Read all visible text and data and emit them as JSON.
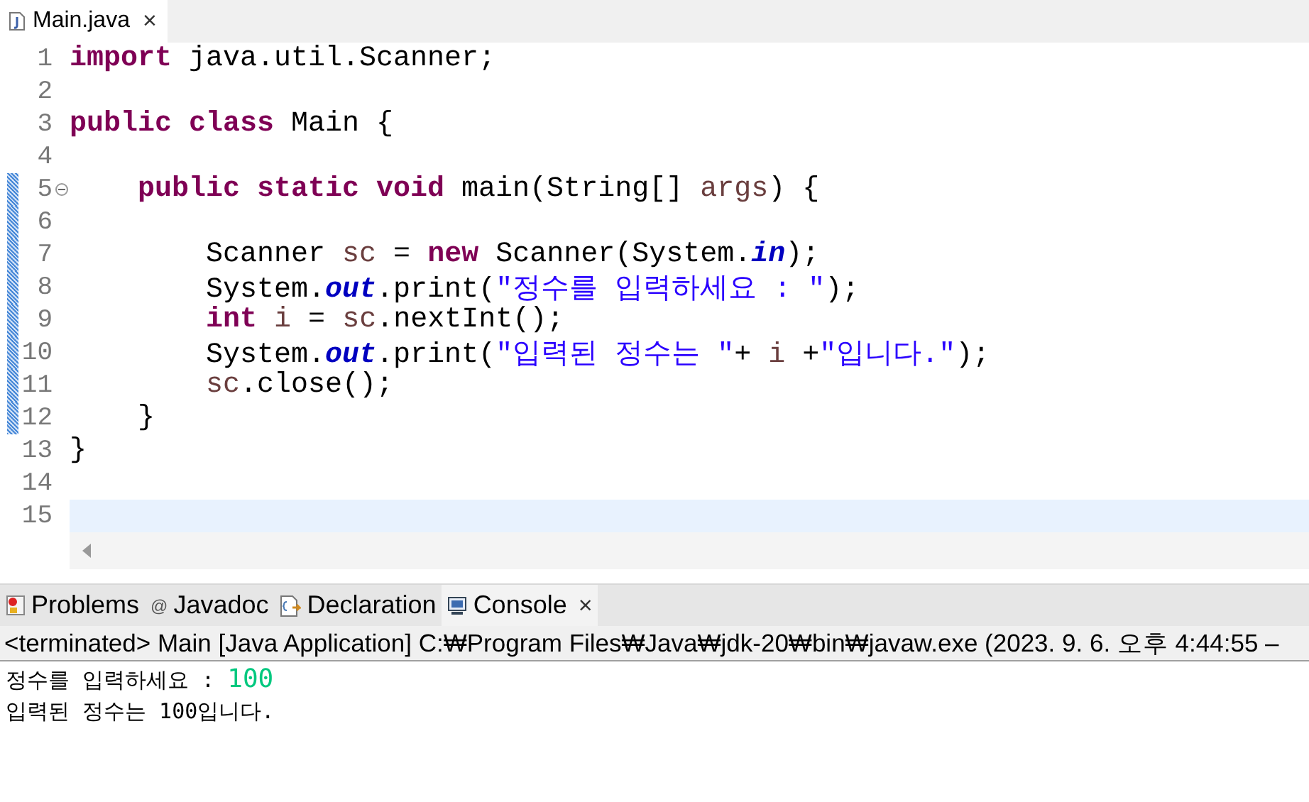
{
  "editor_tabs": [
    {
      "label": "Main.java",
      "selected": true,
      "close": "×"
    }
  ],
  "code": [
    {
      "number": "1",
      "changed": false,
      "current": false,
      "fold": false,
      "tokens": [
        {
          "kind": "kw",
          "text": "import"
        },
        {
          "kind": "plain",
          "text": " java.util.Scanner;"
        }
      ]
    },
    {
      "number": "2",
      "changed": false,
      "current": false,
      "fold": false
    },
    {
      "number": "3",
      "changed": false,
      "current": false,
      "fold": false,
      "tokens": [
        {
          "kind": "kw",
          "text": "public class"
        },
        {
          "kind": "plain",
          "text": " Main {"
        }
      ]
    },
    {
      "number": "4",
      "changed": false,
      "current": false,
      "fold": false
    },
    {
      "number": "5",
      "changed": true,
      "current": false,
      "fold": true,
      "tokens": [
        {
          "kind": "kw",
          "text": "    public static void"
        },
        {
          "kind": "plain",
          "text": " main(String[] "
        },
        {
          "kind": "param",
          "text": "args"
        },
        {
          "kind": "plain",
          "text": ") {"
        }
      ]
    },
    {
      "number": "6",
      "changed": true,
      "current": false,
      "fold": false
    },
    {
      "number": "7",
      "changed": true,
      "current": false,
      "fold": false,
      "tokens": [
        {
          "kind": "plain",
          "text": "        Scanner "
        },
        {
          "kind": "local",
          "text": "sc"
        },
        {
          "kind": "plain",
          "text": " = "
        },
        {
          "kind": "kw",
          "text": "new"
        },
        {
          "kind": "plain",
          "text": " Scanner(System."
        },
        {
          "kind": "field",
          "text": "in"
        },
        {
          "kind": "plain",
          "text": ");"
        }
      ]
    },
    {
      "number": "8",
      "changed": true,
      "current": false,
      "fold": false,
      "tokens": [
        {
          "kind": "plain",
          "text": "        System."
        },
        {
          "kind": "field",
          "text": "out"
        },
        {
          "kind": "plain",
          "text": ".print("
        },
        {
          "kind": "str",
          "text": "\"정수를 입력하세요 : \""
        },
        {
          "kind": "plain",
          "text": ");"
        }
      ]
    },
    {
      "number": "9",
      "changed": true,
      "current": false,
      "fold": false,
      "tokens": [
        {
          "kind": "kw",
          "text": "        int"
        },
        {
          "kind": "local",
          "text": " i"
        },
        {
          "kind": "plain",
          "text": " = "
        },
        {
          "kind": "local",
          "text": "sc"
        },
        {
          "kind": "plain",
          "text": ".nextInt();"
        }
      ]
    },
    {
      "number": "10",
      "changed": true,
      "current": false,
      "fold": false,
      "tokens": [
        {
          "kind": "plain",
          "text": "        System."
        },
        {
          "kind": "field",
          "text": "out"
        },
        {
          "kind": "plain",
          "text": ".print("
        },
        {
          "kind": "str",
          "text": "\"입력된 정수는 \""
        },
        {
          "kind": "plain",
          "text": "+ "
        },
        {
          "kind": "local",
          "text": "i"
        },
        {
          "kind": "plain",
          "text": " +"
        },
        {
          "kind": "str",
          "text": "\"입니다.\""
        },
        {
          "kind": "plain",
          "text": ");"
        }
      ]
    },
    {
      "number": "11",
      "changed": true,
      "current": false,
      "fold": false,
      "tokens": [
        {
          "kind": "local",
          "text": "        sc"
        },
        {
          "kind": "plain",
          "text": ".close();"
        }
      ]
    },
    {
      "number": "12",
      "changed": true,
      "current": false,
      "fold": false,
      "tokens": [
        {
          "kind": "plain",
          "text": "    }"
        }
      ]
    },
    {
      "number": "13",
      "changed": false,
      "current": false,
      "fold": false,
      "tokens": [
        {
          "kind": "plain",
          "text": "}"
        }
      ]
    },
    {
      "number": "14",
      "changed": false,
      "current": false,
      "fold": false
    },
    {
      "number": "15",
      "changed": false,
      "current": true,
      "fold": false
    }
  ],
  "view_tabs": [
    {
      "kind": "problems",
      "label": "Problems",
      "selected": false
    },
    {
      "kind": "javadoc",
      "glyph": "@",
      "label": "Javadoc",
      "selected": false
    },
    {
      "kind": "declaration",
      "label": "Declaration",
      "selected": false
    },
    {
      "kind": "console",
      "label": "Console",
      "selected": true,
      "close": "×"
    }
  ],
  "console": {
    "header": "<terminated> Main [Java Application] C:₩Program Files₩Java₩jdk-20₩bin₩javaw.exe  (2023. 9. 6. 오후 4:44:55 –",
    "lines": [
      {
        "segments": [
          {
            "kind": "out",
            "text": "정수를 입력하세요 : "
          },
          {
            "kind": "in",
            "text": "100"
          }
        ]
      },
      {
        "segments": [
          {
            "kind": "out",
            "text": "입력된 정수는 100입니다."
          }
        ]
      }
    ]
  }
}
